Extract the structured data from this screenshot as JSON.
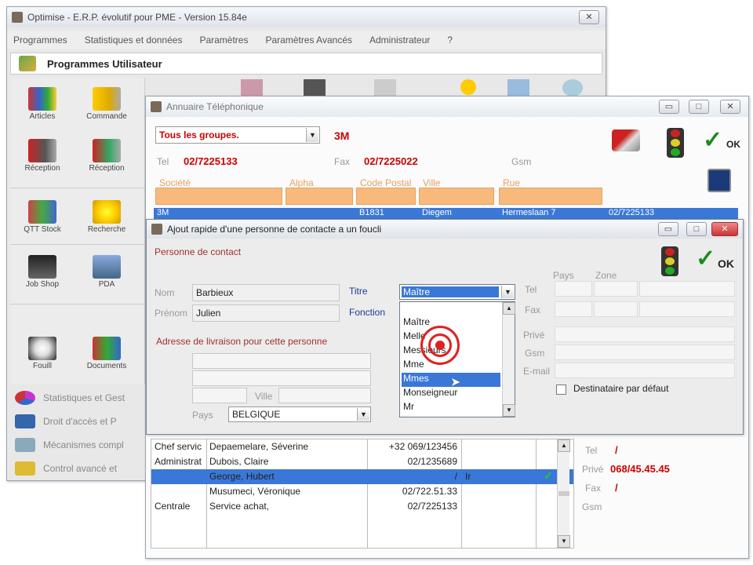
{
  "main_window": {
    "title": "Optimise  -  E.R.P. évolutif pour PME    -  Version 15.84e",
    "menu": [
      "Programmes",
      "Statistiques et données",
      "Paramètres",
      "Paramètres Avancés",
      "Administrateur",
      "?"
    ],
    "panel_title": "Programmes Utilisateur",
    "tiles": [
      {
        "label": "Articles",
        "icon": "boxes-icon"
      },
      {
        "label": "Commande",
        "icon": "truck-icon"
      },
      {
        "label": "Réception",
        "icon": "delivery-truck-icon"
      },
      {
        "label": "Réception",
        "icon": "pda-truck-icon"
      },
      {
        "label": "QTT Stock",
        "icon": "shelves-icon"
      },
      {
        "label": "Recherche",
        "icon": "search-people-icon"
      },
      {
        "label": "Job Shop",
        "icon": "machine-icon"
      },
      {
        "label": "PDA",
        "icon": "pda-icon"
      },
      {
        "label": "Fouill",
        "icon": "detective-icon"
      },
      {
        "label": "Documents",
        "icon": "documents-icon"
      }
    ],
    "side_items": [
      {
        "label": "Statistiques et Gest",
        "icon": "chart-icon"
      },
      {
        "label": "Droit d'accès et P",
        "icon": "tools-icon"
      },
      {
        "label": "Mécanismes compl",
        "icon": "gears-icon"
      },
      {
        "label": "Control avancé et",
        "icon": "control-icon"
      }
    ]
  },
  "annuaire": {
    "title": "Annuaire Téléphonique",
    "group_select": "Tous les groupes.",
    "group_code": "3M",
    "tel_label": "Tel",
    "tel": "02/7225133",
    "fax_label": "Fax",
    "fax": "02/7225022",
    "gsm_label": "Gsm",
    "columns": [
      "Société",
      "Alpha",
      "Code Postal",
      "Ville",
      "Rue"
    ],
    "first_row": {
      "societe": "3M",
      "cp": "B1831",
      "ville": "Diegem",
      "rue": "Hermeslaan 7",
      "tel": "02/7225133"
    },
    "contacts": [
      {
        "fonction": "Chef servic",
        "nom": "Depaemelare, Séverine",
        "tel": "+32 069/123456",
        "titre": "",
        "selected": false
      },
      {
        "fonction": "Administrat",
        "nom": "Dubois, Claire",
        "tel": "02/1235689",
        "titre": "",
        "selected": false
      },
      {
        "fonction": "",
        "nom": "George, Hubert",
        "tel": "/",
        "titre": "Ir",
        "selected": true
      },
      {
        "fonction": "",
        "nom": "Musumeci, Véronique",
        "tel": "02/722.51.33",
        "titre": "",
        "selected": false
      },
      {
        "fonction": "Centrale",
        "nom": "Service achat,",
        "tel": "02/7225133",
        "titre": "",
        "selected": false
      }
    ],
    "right_info": {
      "tel_label": "Tel",
      "tel": "/",
      "prive_label": "Privé",
      "prive": "068/45.45.45",
      "fax_label": "Fax",
      "fax": "/",
      "gsm_label": "Gsm"
    },
    "ok_label": "OK"
  },
  "ajout": {
    "title": "Ajout rapide d'une personne de contacte a un foucli",
    "section_contact": "Personne de contact",
    "nom_label": "Nom",
    "nom": "Barbieux",
    "prenom_label": "Prénom",
    "prenom": "Julien",
    "titre_label": "Titre",
    "titre_value": "Maître",
    "fonction_label": "Fonction",
    "titre_options": [
      "Maître",
      "Melle",
      "Messieurs",
      "Mme",
      "Mmes",
      "Monseigneur",
      "Mr"
    ],
    "highlighted_option": 4,
    "adresse_label": "Adresse de livraison pour cette personne",
    "ville_label": "Ville",
    "pays_label": "Pays",
    "pays": "BELGIQUE",
    "phone_headers": [
      "Pays",
      "Zone"
    ],
    "tel_label": "Tel",
    "fax_label": "Fax",
    "prive_label": "Privé",
    "gsm_label": "Gsm",
    "email_label": "E-mail",
    "dest_label": "Destinataire par défaut",
    "ok_label": "OK"
  },
  "colors": {
    "accent_blue": "#3a78d8",
    "header_orange": "#f8b97d",
    "red_text": "#cc0000",
    "ok_green": "#1c8a1c"
  }
}
